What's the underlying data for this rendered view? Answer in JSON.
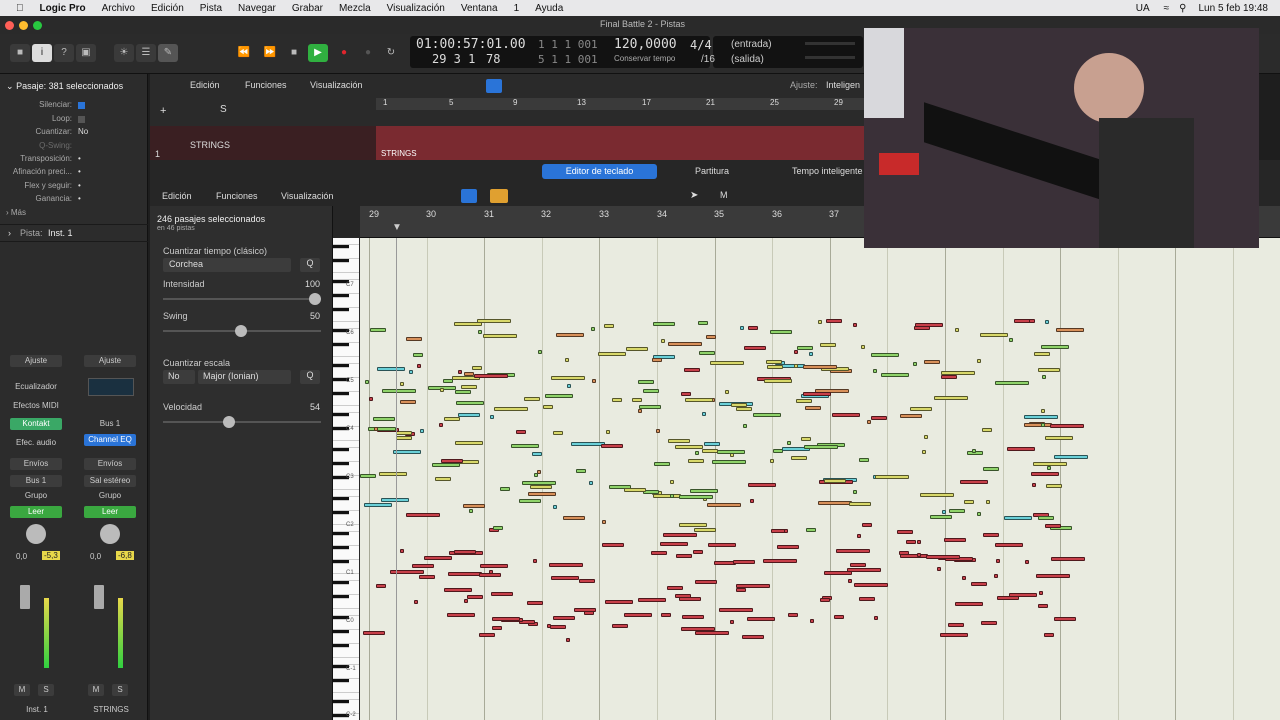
{
  "menubar": {
    "app": "Logic Pro",
    "items": [
      "Archivo",
      "Edición",
      "Pista",
      "Navegar",
      "Grabar",
      "Mezcla",
      "Visualización",
      "Ventana",
      "1",
      "Ayuda"
    ],
    "input_source": "UA",
    "clock": "Lun 5 feb  19:48"
  },
  "window": {
    "title": "Final Battle 2 - Pistas"
  },
  "lcd": {
    "smpte": "01:00:57:01.00",
    "bars_top": "1  1  1  001",
    "pos": "29  3  1",
    "ticks": "78",
    "bars_bottom": "5  1  1  001",
    "tempo": "120,0000",
    "tempo_mode": "Conservar tempo",
    "sig_num": "4/4",
    "sig_den": "/16",
    "in": "(entrada)",
    "out": "(salida)"
  },
  "inspector": {
    "region_title": "Pasaje: 381 seleccionados",
    "rows": [
      {
        "k": "Silenciar:",
        "v": ""
      },
      {
        "k": "Loop:",
        "v": ""
      },
      {
        "k": "Cuantizar:",
        "v": "No"
      },
      {
        "k": "Q-Swing:",
        "v": ""
      },
      {
        "k": "Transposición:",
        "v": "•"
      },
      {
        "k": "Afinación preci...",
        "v": "•"
      },
      {
        "k": "Flex y seguir:",
        "v": "•"
      },
      {
        "k": "Ganancia:",
        "v": "•"
      }
    ],
    "more": "Más",
    "track_label": "Pista:",
    "track_name": "Inst. 1"
  },
  "strips": [
    {
      "setting": "Ajuste",
      "eq": "Ecualizador",
      "midi": "Efectos MIDI",
      "instrument": "Kontakt",
      "audio_fx": "Efec. audio",
      "sends": "Envíos",
      "output": "Bus 1",
      "group": "Grupo",
      "automation": "Leer",
      "pan_val": "0,0",
      "vol": "-5,3",
      "m": "M",
      "s": "S",
      "name": "Inst. 1"
    },
    {
      "setting": "Ajuste",
      "eq": "",
      "midi": "",
      "instrument": "Bus 1",
      "audio_fx": "Channel EQ",
      "sends": "Envíos",
      "output": "Sal estéreo",
      "group": "Grupo",
      "automation": "Leer",
      "pan_val": "0,0",
      "vol": "-6,8",
      "m": "M",
      "s": "S",
      "name": "STRINGS"
    }
  ],
  "tracks_area": {
    "menus": [
      "Edición",
      "Funciones",
      "Visualización"
    ],
    "snap_label": "Ajuste:",
    "snap_value": "Inteligen",
    "track_num": "1",
    "track_name": "STRINGS",
    "region_name": "STRINGS",
    "ruler": [
      "1",
      "5",
      "9",
      "13",
      "17",
      "21",
      "25",
      "29"
    ]
  },
  "editor": {
    "tabs": [
      "Editor de teclado",
      "Partitura",
      "Tempo inteligente"
    ],
    "menus": [
      "Edición",
      "Funciones",
      "Visualización"
    ],
    "ruler": [
      "29",
      "30",
      "31",
      "32",
      "33",
      "34",
      "35",
      "36",
      "37"
    ]
  },
  "quantize": {
    "selected": "246 pasajes seleccionados",
    "sub": "en 46 pistas",
    "title": "Cuantizar tiempo (clásico)",
    "value": "Corchea",
    "q": "Q",
    "intensity_label": "Intensidad",
    "intensity": "100",
    "swing_label": "Swing",
    "swing": "50",
    "scale_label": "Cuantizar escala",
    "scale_off": "No",
    "scale": "Major (Ionian)",
    "velocity_label": "Velocidad",
    "velocity": "54"
  },
  "piano_labels": [
    "C7",
    "C6",
    "C5",
    "C4",
    "C3",
    "C2",
    "C1",
    "C0",
    "C-1",
    "C-2"
  ],
  "colors": {
    "green": "#8fd36a",
    "yellow": "#d8d86a",
    "red": "#c8404a",
    "orange": "#d8905a",
    "cyan": "#6ad0d8",
    "blue": "#4a80c8",
    "accent": "#2a74d8",
    "record": "#e0252d",
    "play": "#30b040"
  }
}
